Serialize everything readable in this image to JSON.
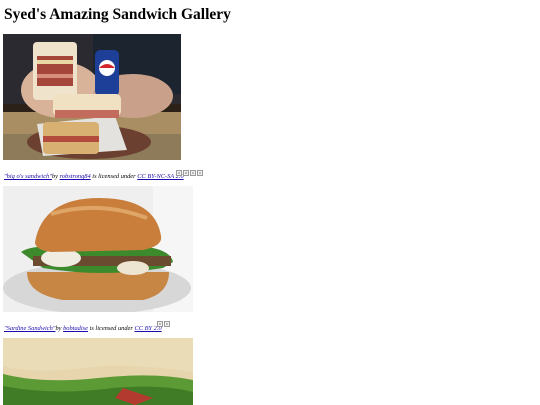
{
  "page": {
    "title": "Syed's Amazing Sandwich Gallery"
  },
  "gallery": [
    {
      "image_alt": "Big-o's sandwich",
      "credit": {
        "title": "\"big o's sandwich\"",
        "by": "by ",
        "author": "robstrong84",
        "license_text": " is licensed under ",
        "license": "CC BY-NC-SA 2.0"
      },
      "badge_count": 4
    },
    {
      "image_alt": "Sardine Sandwich",
      "credit": {
        "title": "\"Sardine Sandwich\"",
        "by": "by ",
        "author": "bobtadise",
        "license_text": " is licensed under ",
        "license": "CC BY 2.0"
      },
      "badge_count": 2
    },
    {
      "image_alt": "Grilled sandwich",
      "credit": null,
      "badge_count": 0
    }
  ]
}
